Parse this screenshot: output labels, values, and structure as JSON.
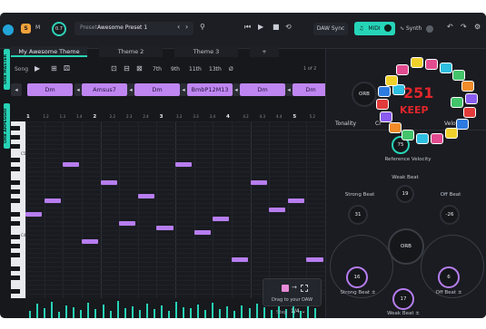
{
  "topbar": {
    "s_badge": "S",
    "m_label": "M",
    "knob_value": "0.7",
    "preset_label": "Preset",
    "preset_name": "Awesome Preset 1",
    "daw_sync": "DAW Sync",
    "midi": "MIDI",
    "synth": "Synth"
  },
  "tabs": [
    {
      "label": "My Awesome Theme"
    },
    {
      "label": "Theme 2"
    },
    {
      "label": "Theme 3"
    },
    {
      "label": "+"
    }
  ],
  "side_labels": {
    "master": "ORB MASTER",
    "arpeggio": "ORB ARPEGGIO"
  },
  "toolbar": {
    "song_label": "Song",
    "ext_7": "7th",
    "ext_9": "9th",
    "ext_11": "11th",
    "ext_13": "13th",
    "ext_none": "Ø",
    "page": "1 of 2"
  },
  "chords": [
    "Dm",
    "Amsus7",
    "Dm",
    "BmbP12M13",
    "Dm",
    "Dm"
  ],
  "ruler": [
    "1",
    "1.2",
    "1.3",
    "1.4",
    "2",
    "2.2",
    "2.3",
    "2.4",
    "3",
    "3.2",
    "3.3",
    "3.4",
    "4",
    "4.2",
    "4.3",
    "4.4",
    "5",
    "5.2"
  ],
  "key_labels": [
    "C5",
    "C4"
  ],
  "drag": {
    "text": "Drag to your DAW"
  },
  "step": {
    "label": "Step",
    "value": "1/4"
  },
  "right_panel": {
    "orb_top": "ORB",
    "tabs": [
      "Tonality",
      "Cr",
      "Velocity"
    ],
    "ref_velocity_value": "75",
    "ref_velocity_label": "Reference Velocity",
    "weak_beat_label": "Weak Beat",
    "weak_beat_value": "19",
    "strong_beat_label": "Strong Beat",
    "strong_beat_value": "31",
    "off_beat_label": "Off Beat",
    "off_beat_value": "-26",
    "orb_center": "ORB",
    "strong_beat2_label": "Strong Beat ±",
    "strong_beat2_value": "16",
    "off_beat2_label": "Off Beat ±",
    "off_beat2_value": "6",
    "weak_beat2_label": "Weak Beat ±",
    "weak_beat2_value": "17"
  },
  "overlay": {
    "text": "251",
    "subtext": "KEEP"
  },
  "colors": {
    "accent": "#27d3b6",
    "note": "#b77df0",
    "chord": "#bf86f2",
    "orange": "#f2a23a"
  },
  "notes": [
    {
      "bar": 1.0,
      "pitch": 20,
      "len": 0.22
    },
    {
      "bar": 1.25,
      "pitch": 17,
      "len": 0.22
    },
    {
      "bar": 1.5,
      "pitch": 9,
      "len": 0.22
    },
    {
      "bar": 1.75,
      "pitch": 26,
      "len": 0.22
    },
    {
      "bar": 2.0,
      "pitch": 13,
      "len": 0.22
    },
    {
      "bar": 2.25,
      "pitch": 22,
      "len": 0.22
    },
    {
      "bar": 2.5,
      "pitch": 16,
      "len": 0.22
    },
    {
      "bar": 2.75,
      "pitch": 23,
      "len": 0.22
    },
    {
      "bar": 3.0,
      "pitch": 9,
      "len": 0.22
    },
    {
      "bar": 3.25,
      "pitch": 24,
      "len": 0.22
    },
    {
      "bar": 3.5,
      "pitch": 21,
      "len": 0.22
    },
    {
      "bar": 3.75,
      "pitch": 30,
      "len": 0.22
    },
    {
      "bar": 4.0,
      "pitch": 13,
      "len": 0.22
    },
    {
      "bar": 4.25,
      "pitch": 19,
      "len": 0.22
    },
    {
      "bar": 4.5,
      "pitch": 17,
      "len": 0.22
    },
    {
      "bar": 4.75,
      "pitch": 30,
      "len": 0.22
    }
  ],
  "velocities": [
    40,
    80,
    55,
    90,
    35,
    70,
    60,
    45,
    85,
    50,
    75,
    40,
    95,
    55,
    65,
    45,
    80,
    50,
    70,
    40,
    90,
    60,
    55,
    75,
    45,
    85,
    50,
    65,
    40,
    70,
    55,
    80,
    60,
    45,
    75,
    50,
    85,
    40,
    65,
    55
  ]
}
